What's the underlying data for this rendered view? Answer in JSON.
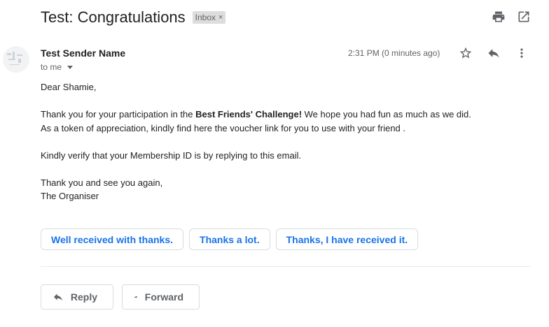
{
  "header": {
    "subject": "Test: Congratulations",
    "label": "Inbox",
    "label_remove": "×"
  },
  "top_icons": [
    "print-icon",
    "open-in-new-window-icon"
  ],
  "message": {
    "sender_name": "Test Sender Name",
    "recipient": "to me",
    "timestamp": "2:31 PM (0 minutes ago)",
    "actions": [
      "star-icon",
      "reply-icon",
      "more-vert-icon"
    ],
    "body": {
      "greeting": "Dear Shamie,",
      "para1_before": "Thank you for your participation in the ",
      "para1_bold": "Best Friends' Challenge!",
      "para1_after": " We hope you had fun as much as we did.",
      "para2": "As a token of appreciation, kindly find here the voucher link for you to use with your friend .",
      "para3": "Kindly verify that your Membership ID is by replying to this email.",
      "closing1": "Thank you and see you again,",
      "closing2": "The Organiser"
    }
  },
  "smart_replies": [
    "Well received with thanks.",
    "Thanks a lot.",
    "Thanks, I have received it."
  ],
  "bottom_actions": {
    "reply": "Reply",
    "forward": "Forward"
  },
  "colors": {
    "accent": "#1a73e8",
    "text": "#202124",
    "muted": "#5f6368",
    "chip_bg": "#dddddd",
    "border": "#dadce0"
  }
}
